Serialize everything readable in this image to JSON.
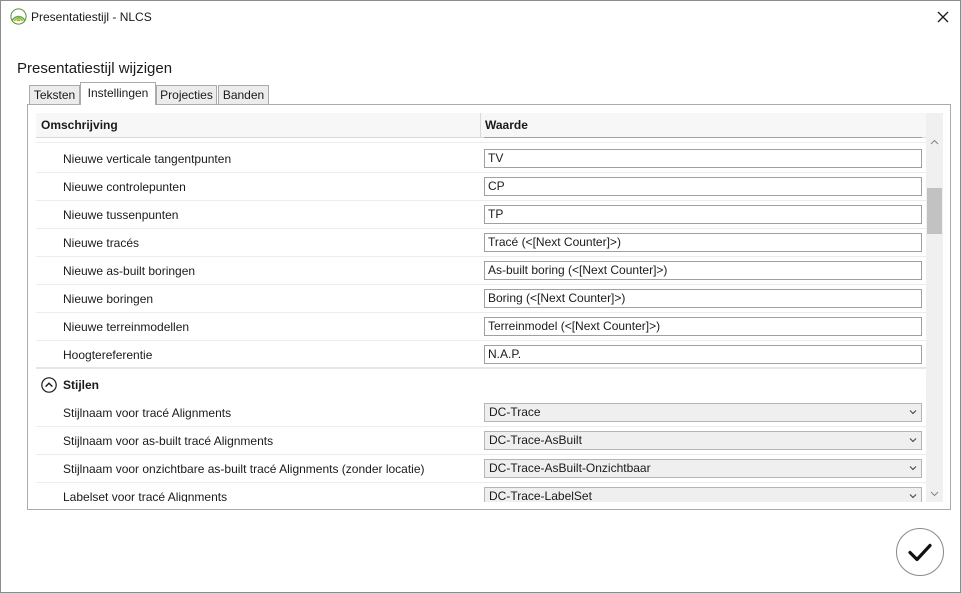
{
  "window": {
    "title": "Presentatiestijl - NLCS"
  },
  "dialog": {
    "heading": "Presentatiestijl wijzigen"
  },
  "tabs": [
    {
      "label": "Teksten",
      "active": false
    },
    {
      "label": "Instellingen",
      "active": true
    },
    {
      "label": "Projecties",
      "active": false
    },
    {
      "label": "Banden",
      "active": false
    }
  ],
  "grid": {
    "columns": {
      "description": "Omschrijving",
      "value": "Waarde"
    },
    "rows": [
      {
        "label": "Nieuwe verticale tangentpunten",
        "value": "TV"
      },
      {
        "label": "Nieuwe controlepunten",
        "value": "CP"
      },
      {
        "label": "Nieuwe tussenpunten",
        "value": "TP"
      },
      {
        "label": "Nieuwe tracés",
        "value": "Tracé (<[Next Counter]>)"
      },
      {
        "label": "Nieuwe as-built boringen",
        "value": "As-built boring (<[Next Counter]>)"
      },
      {
        "label": "Nieuwe boringen",
        "value": "Boring (<[Next Counter]>)"
      },
      {
        "label": "Nieuwe terreinmodellen",
        "value": "Terreinmodel (<[Next Counter]>)"
      },
      {
        "label": "Hoogtereferentie",
        "value": "N.A.P."
      }
    ],
    "group": {
      "label": "Stijlen",
      "expanded": true
    },
    "style_rows": [
      {
        "label": "Stijlnaam voor tracé Alignments",
        "value": "DC-Trace"
      },
      {
        "label": "Stijlnaam voor as-built tracé Alignments",
        "value": "DC-Trace-AsBuilt"
      },
      {
        "label": "Stijlnaam voor onzichtbare as-built tracé Alignments (zonder locatie)",
        "value": "DC-Trace-AsBuilt-Onzichtbaar"
      },
      {
        "label": "Labelset voor tracé Alignments",
        "value": "DC-Trace-LabelSet"
      }
    ]
  },
  "icons": {
    "app": "nlcs-logo-icon",
    "close": "close-icon",
    "ok": "checkmark-icon",
    "collapse": "chevron-up-circle-icon",
    "dropdown": "chevron-down-icon"
  },
  "colors": {
    "accent_icon": "#6aa84f",
    "border": "#ababab"
  }
}
